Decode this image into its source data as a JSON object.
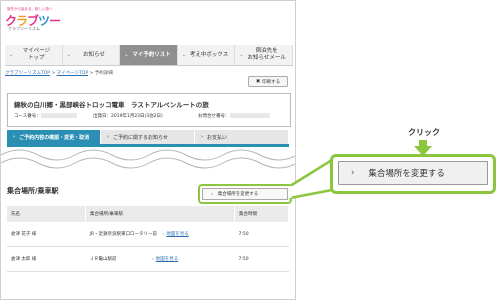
{
  "logo": {
    "tagline": "旅先から始まる、新しい旅へ",
    "main": "クラブツーリズム",
    "sub": "クラブツーリズム"
  },
  "nav": {
    "items": [
      {
        "label": "マイページ\nトップ",
        "active": false
      },
      {
        "label": "お知らせ",
        "active": false
      },
      {
        "label": "マイ予約リスト",
        "active": true
      },
      {
        "label": "考え中ボックス",
        "active": false
      },
      {
        "label": "宿泊先を\nお知らせメール",
        "active": false
      }
    ]
  },
  "breadcrumb": {
    "link1": "クラブツーリズムTOP",
    "sep": " > ",
    "link2": "マイページTOP",
    "current": "予約詳細"
  },
  "print_label": "印刷する",
  "tour": {
    "title": "錦秋の白川郷・黒部峡谷トロッコ電車　ラストアルペンルートの旅",
    "course_label": "コース番号：",
    "date_label": "出発日：2019年1月23日(3泊2日)",
    "reservation_label": "お問合せ番号："
  },
  "tabs": [
    {
      "label": "ご予約内容の確認・変更・取消",
      "active": true
    },
    {
      "label": "ご予約に関するお知らせ",
      "active": false
    },
    {
      "label": "お支払い",
      "active": false
    }
  ],
  "cut_heading": "ご予",
  "cut_heading_tail": "更",
  "section": {
    "title": "集合場所/乗車駅",
    "change_button": "集合場所を変更する"
  },
  "table": {
    "headers": [
      "氏名",
      "集合場所/乗車駅",
      "集合時間"
    ],
    "rows": [
      {
        "name": "倉津 花子 様",
        "place": "JR・近鉄奈良駅東口ロータリー前",
        "link": "地図を見る",
        "time": "7:50"
      },
      {
        "name": "倉津 太郎 様",
        "place": "ＪＲ亀山駅前",
        "link": "地図を見る",
        "time": "7:50"
      }
    ]
  },
  "callout": {
    "click_label": "クリック",
    "button_label": "集合場所を変更する",
    "accent": "#8cc63f"
  }
}
